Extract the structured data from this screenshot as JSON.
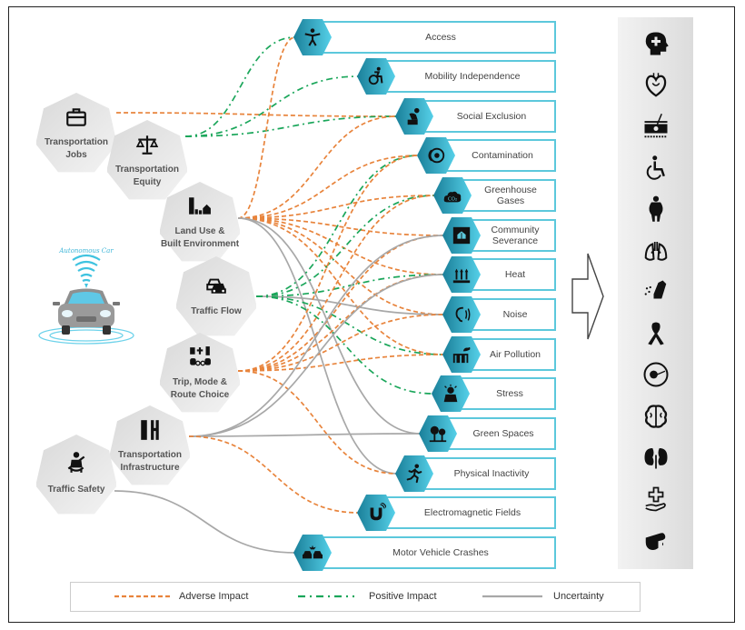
{
  "sources": [
    {
      "id": "jobs",
      "label_lines": [
        "Transportation",
        "Jobs"
      ],
      "icon": "briefcase-icon"
    },
    {
      "id": "equity",
      "label_lines": [
        "Transportation",
        "Equity"
      ],
      "icon": "scales-icon"
    },
    {
      "id": "landuse",
      "label_lines": [
        "Land Use &",
        "Built Environment"
      ],
      "icon": "buildings-house-icon"
    },
    {
      "id": "traffic",
      "label_lines": [
        "Traffic Flow"
      ],
      "icon": "cars-icon"
    },
    {
      "id": "trip",
      "label_lines": [
        "Trip, Mode &",
        "Route Choice"
      ],
      "icon": "transport-modes-icon"
    },
    {
      "id": "infra",
      "label_lines": [
        "Transportation",
        "Infrastructure"
      ],
      "icon": "infrastructure-icon"
    },
    {
      "id": "safety",
      "label_lines": [
        "Traffic Safety"
      ],
      "icon": "seatbelt-icon"
    }
  ],
  "autonomous_car": {
    "caption": "Autonomous Car",
    "icon": "autonomous-car-icon"
  },
  "outcomes": [
    {
      "id": "access",
      "label": "Access",
      "icon": "person-arms-out-icon"
    },
    {
      "id": "mobility",
      "label": "Mobility Independence",
      "icon": "wheelchair-active-icon"
    },
    {
      "id": "exclusion",
      "label": "Social Exclusion",
      "icon": "sitting-person-icon"
    },
    {
      "id": "contamination",
      "label": "Contamination",
      "icon": "brake-disc-icon"
    },
    {
      "id": "ghg",
      "label": "Greenhouse Gases",
      "icon": "co2-cloud-icon"
    },
    {
      "id": "severance",
      "label": "Community Severance",
      "icon": "house-split-icon"
    },
    {
      "id": "heat",
      "label": "Heat",
      "icon": "heat-waves-icon"
    },
    {
      "id": "noise",
      "label": "Noise",
      "icon": "ear-sound-icon"
    },
    {
      "id": "air",
      "label": "Air Pollution",
      "icon": "factory-smoke-icon"
    },
    {
      "id": "stress",
      "label": "Stress",
      "icon": "stressed-person-icon"
    },
    {
      "id": "green",
      "label": "Green Spaces",
      "icon": "trees-icon"
    },
    {
      "id": "inactivity",
      "label": "Physical Inactivity",
      "icon": "runner-icon"
    },
    {
      "id": "emf",
      "label": "Electromagnetic Fields",
      "icon": "magnet-icon"
    },
    {
      "id": "crashes",
      "label": "Motor Vehicle Crashes",
      "icon": "car-crash-icon"
    }
  ],
  "health_outcomes": [
    {
      "icon": "mental-health-head-icon"
    },
    {
      "icon": "heart-icon"
    },
    {
      "icon": "skin-icon"
    },
    {
      "icon": "disability-icon"
    },
    {
      "icon": "obesity-icon"
    },
    {
      "icon": "lungs-icon"
    },
    {
      "icon": "inhaler-icon"
    },
    {
      "icon": "cancer-ribbon-icon"
    },
    {
      "icon": "fertility-icon"
    },
    {
      "icon": "brain-icon"
    },
    {
      "icon": "kidneys-icon"
    },
    {
      "icon": "healthcare-hand-icon"
    },
    {
      "icon": "blood-test-icon"
    }
  ],
  "links": [
    {
      "from": "jobs",
      "to": "exclusion",
      "type": "adverse"
    },
    {
      "from": "equity",
      "to": "access",
      "type": "positive"
    },
    {
      "from": "equity",
      "to": "mobility",
      "type": "positive"
    },
    {
      "from": "equity",
      "to": "exclusion",
      "type": "positive"
    },
    {
      "from": "landuse",
      "to": "access",
      "type": "adverse"
    },
    {
      "from": "landuse",
      "to": "exclusion",
      "type": "adverse"
    },
    {
      "from": "landuse",
      "to": "contamination",
      "type": "adverse"
    },
    {
      "from": "landuse",
      "to": "ghg",
      "type": "adverse"
    },
    {
      "from": "landuse",
      "to": "severance",
      "type": "adverse"
    },
    {
      "from": "landuse",
      "to": "heat",
      "type": "adverse"
    },
    {
      "from": "landuse",
      "to": "noise",
      "type": "adverse"
    },
    {
      "from": "landuse",
      "to": "air",
      "type": "adverse"
    },
    {
      "from": "landuse",
      "to": "green",
      "type": "uncertainty"
    },
    {
      "from": "landuse",
      "to": "inactivity",
      "type": "uncertainty"
    },
    {
      "from": "traffic",
      "to": "contamination",
      "type": "positive"
    },
    {
      "from": "traffic",
      "to": "ghg",
      "type": "positive"
    },
    {
      "from": "traffic",
      "to": "heat",
      "type": "positive"
    },
    {
      "from": "traffic",
      "to": "noise",
      "type": "uncertainty"
    },
    {
      "from": "traffic",
      "to": "air",
      "type": "positive"
    },
    {
      "from": "traffic",
      "to": "stress",
      "type": "positive"
    },
    {
      "from": "trip",
      "to": "contamination",
      "type": "adverse"
    },
    {
      "from": "trip",
      "to": "ghg",
      "type": "adverse"
    },
    {
      "from": "trip",
      "to": "severance",
      "type": "adverse"
    },
    {
      "from": "trip",
      "to": "heat",
      "type": "adverse"
    },
    {
      "from": "trip",
      "to": "noise",
      "type": "adverse"
    },
    {
      "from": "trip",
      "to": "air",
      "type": "adverse"
    },
    {
      "from": "trip",
      "to": "inactivity",
      "type": "adverse"
    },
    {
      "from": "infra",
      "to": "severance",
      "type": "uncertainty"
    },
    {
      "from": "infra",
      "to": "heat",
      "type": "uncertainty"
    },
    {
      "from": "infra",
      "to": "green",
      "type": "uncertainty"
    },
    {
      "from": "infra",
      "to": "emf",
      "type": "adverse"
    },
    {
      "from": "safety",
      "to": "crashes",
      "type": "uncertainty"
    }
  ],
  "legend": [
    {
      "type": "adverse",
      "label": "Adverse Impact",
      "color": "#e8843c"
    },
    {
      "type": "positive",
      "label": "Positive Impact",
      "color": "#1aa65a"
    },
    {
      "type": "uncertainty",
      "label": "Uncertainty",
      "color": "#a8a8a8"
    }
  ],
  "colors": {
    "accent": "#3fc0da",
    "accent_dark": "#1a7f99",
    "box_border": "#5cc8dc",
    "hex_gray": "#e4e4e4"
  }
}
